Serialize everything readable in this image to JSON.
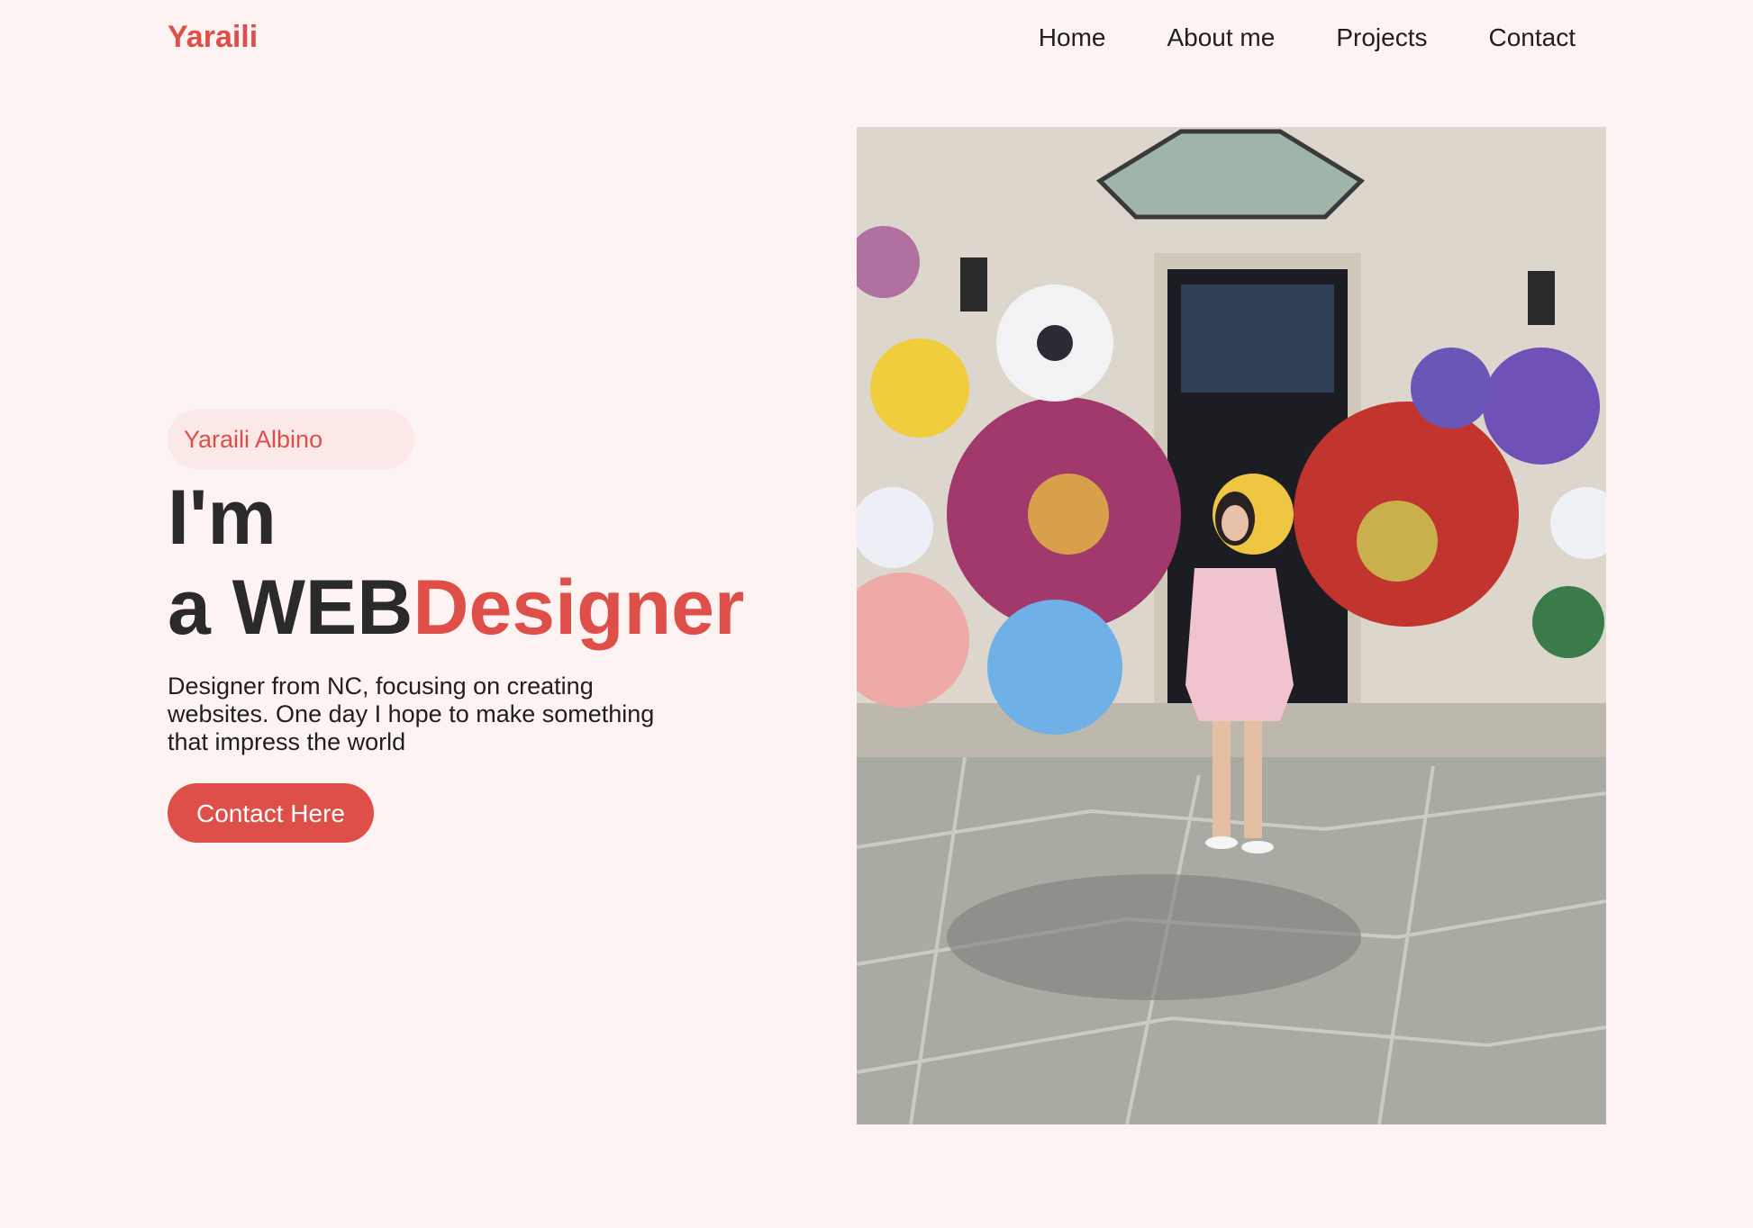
{
  "header": {
    "brand": "Yaraili",
    "nav": [
      {
        "label": "Home"
      },
      {
        "label": "About me"
      },
      {
        "label": "Projects"
      },
      {
        "label": "Contact"
      }
    ]
  },
  "hero": {
    "name_tag": "Yaraili Albino",
    "headline_line1": "I'm",
    "headline_line2_prefix": "a WEB",
    "headline_line2_accent": "Designer",
    "description": "Designer from NC, focusing on creating websites. One day I hope to make something that impress the world",
    "cta_label": "Contact Here"
  },
  "colors": {
    "accent": "#df4f49",
    "background": "#fdf3f2",
    "pill_background": "#fbe9e7",
    "text": "#2a2a2a"
  }
}
